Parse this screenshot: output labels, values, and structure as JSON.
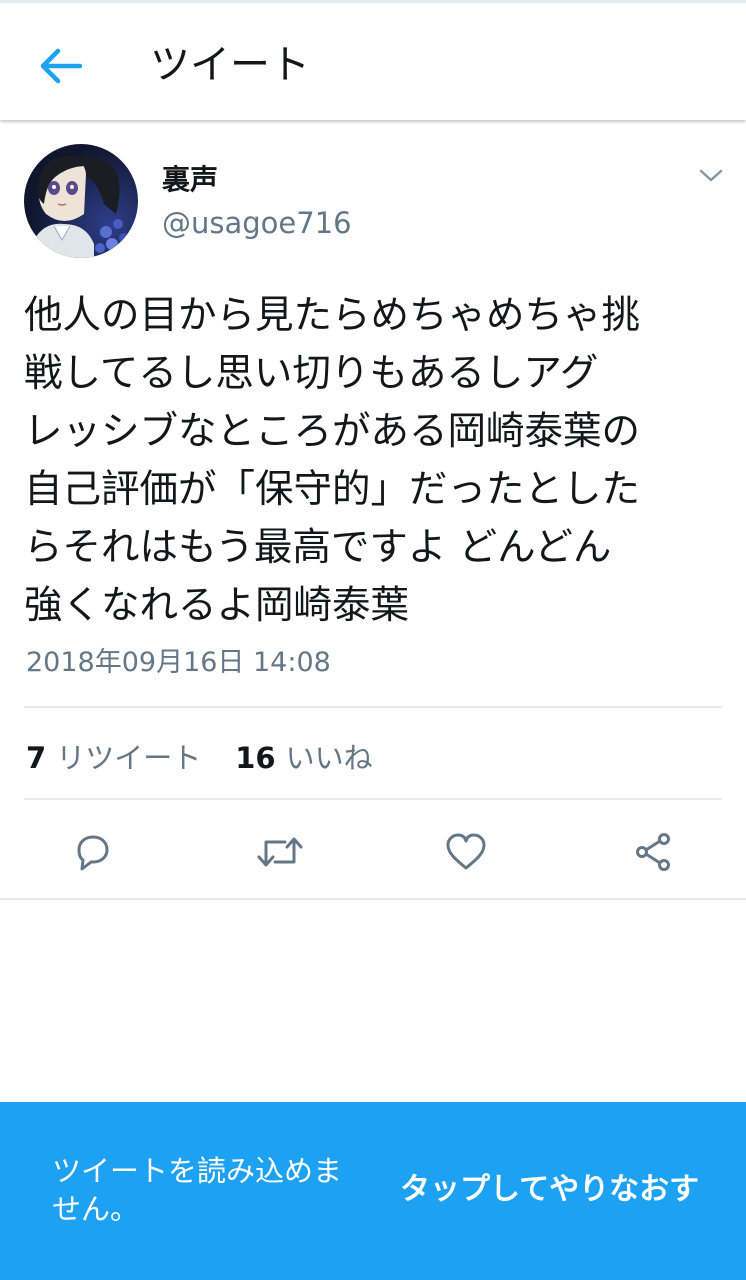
{
  "header": {
    "title": "ツイート",
    "back_icon": "arrow-left-icon",
    "accent_color": "#1da1f2"
  },
  "tweet": {
    "author": {
      "display_name": "裏声",
      "username": "@usagoe716",
      "avatar": "avatar-illustration"
    },
    "text_lines": [
      "他人の目から見たらめちゃめちゃ挑",
      "戦してるし思い切りもあるしアグ",
      "レッシブなところがある岡崎泰葉の",
      "自己評価が「保守的」だったとした",
      "らそれはもう最高ですよ どんどん",
      "強くなれるよ岡崎泰葉"
    ],
    "timestamp": "2018年09月16日 14:08",
    "stats": {
      "retweets_count": "7",
      "retweets_label": "リツイート",
      "likes_count": "16",
      "likes_label": "いいね"
    },
    "actions": [
      {
        "name": "reply",
        "icon": "reply-icon"
      },
      {
        "name": "retweet",
        "icon": "retweet-icon"
      },
      {
        "name": "like",
        "icon": "heart-icon"
      },
      {
        "name": "share",
        "icon": "share-icon"
      }
    ]
  },
  "snackbar": {
    "message": "ツイートを読み込めません。",
    "action_label": "タップしてやりなおす",
    "background_color": "#1da1f2"
  },
  "colors": {
    "text_primary": "#14171a",
    "text_secondary": "#657786",
    "icon_gray": "#657786",
    "divider": "#e6ecf0"
  }
}
